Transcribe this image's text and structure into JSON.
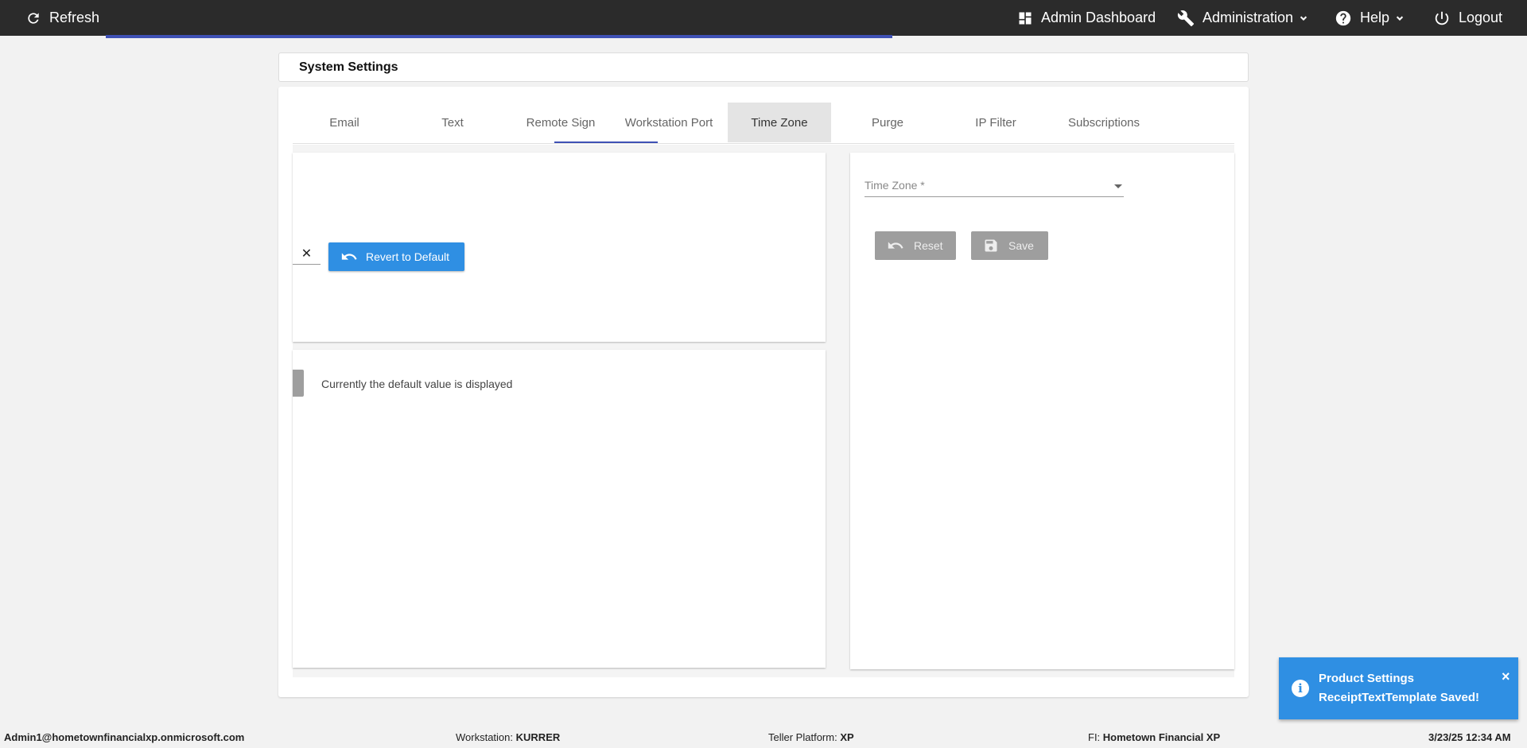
{
  "topbar": {
    "refresh": "Refresh",
    "admin_dashboard": "Admin Dashboard",
    "administration": "Administration",
    "help": "Help",
    "logout": "Logout"
  },
  "page": {
    "title": "System Settings"
  },
  "tabs": [
    {
      "label": "Email"
    },
    {
      "label": "Text"
    },
    {
      "label": "Remote Sign"
    },
    {
      "label": "Workstation Port"
    },
    {
      "label": "Time Zone"
    },
    {
      "label": "Purge"
    },
    {
      "label": "IP Filter"
    },
    {
      "label": "Subscriptions"
    }
  ],
  "left_panel": {
    "clear_symbol": "✕",
    "revert_label": "Revert to Default",
    "default_message": "Currently the default value is displayed"
  },
  "time_zone_panel": {
    "field_label": "Time Zone *",
    "reset_label": "Reset",
    "save_label": "Save"
  },
  "toast": {
    "line1": "Product Settings",
    "line2": "ReceiptTextTemplate Saved!",
    "close": "×"
  },
  "footer": {
    "user": "Admin1@hometownfinancialxp.onmicrosoft.com",
    "workstation_label": "Workstation:",
    "workstation_value": "KURRER",
    "platform_label": "Teller Platform:",
    "platform_value": "XP",
    "fi_label": "FI:",
    "fi_value": "Hometown Financial XP",
    "datetime": "3/23/25 12:34 AM"
  },
  "colors": {
    "topbar": "#2b2b2b",
    "accent": "#3f51b5",
    "primary_button": "#2f8fe3",
    "disabled_button": "#9e9e9e"
  }
}
